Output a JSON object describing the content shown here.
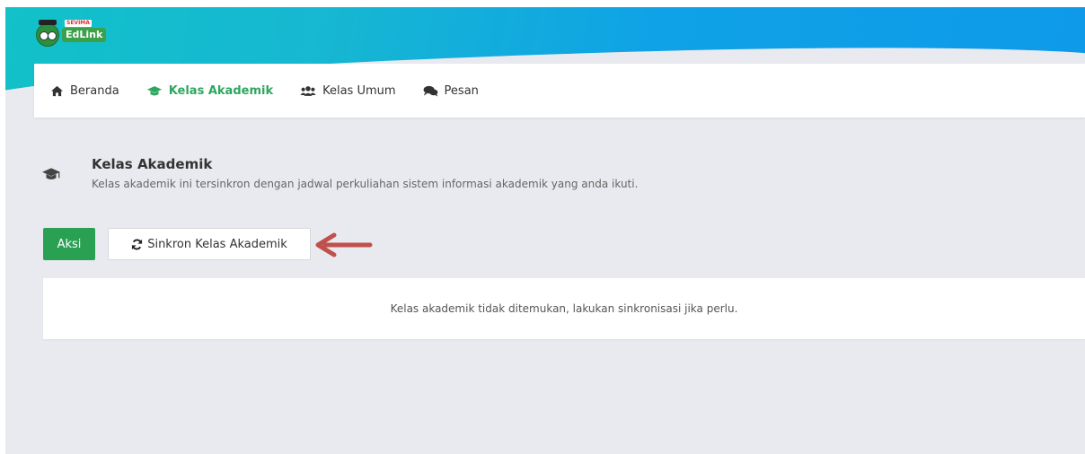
{
  "app": {
    "brand": "EdLink",
    "brand_tag": "SEVIMA"
  },
  "nav": {
    "items": [
      {
        "label": "Beranda",
        "icon": "home-icon"
      },
      {
        "label": "Kelas Akademik",
        "icon": "graduation-cap-icon",
        "active": true
      },
      {
        "label": "Kelas Umum",
        "icon": "users-icon"
      },
      {
        "label": "Pesan",
        "icon": "comments-icon"
      }
    ]
  },
  "section": {
    "title": "Kelas Akademik",
    "description": "Kelas akademik ini tersinkron dengan jadwal perkuliahan sistem informasi akademik yang anda ikuti."
  },
  "actions": {
    "aksi_label": "Aksi",
    "sync_label": "Sinkron Kelas Akademik"
  },
  "empty_message": "Kelas akademik tidak ditemukan, lakukan sinkronisasi jika perlu.",
  "colors": {
    "accent_green": "#2aa053",
    "active_nav": "#2ea660",
    "annotation_arrow": "#c0504d",
    "header_gradient_start": "#12c1c9",
    "header_gradient_end": "#0e9ae9"
  }
}
